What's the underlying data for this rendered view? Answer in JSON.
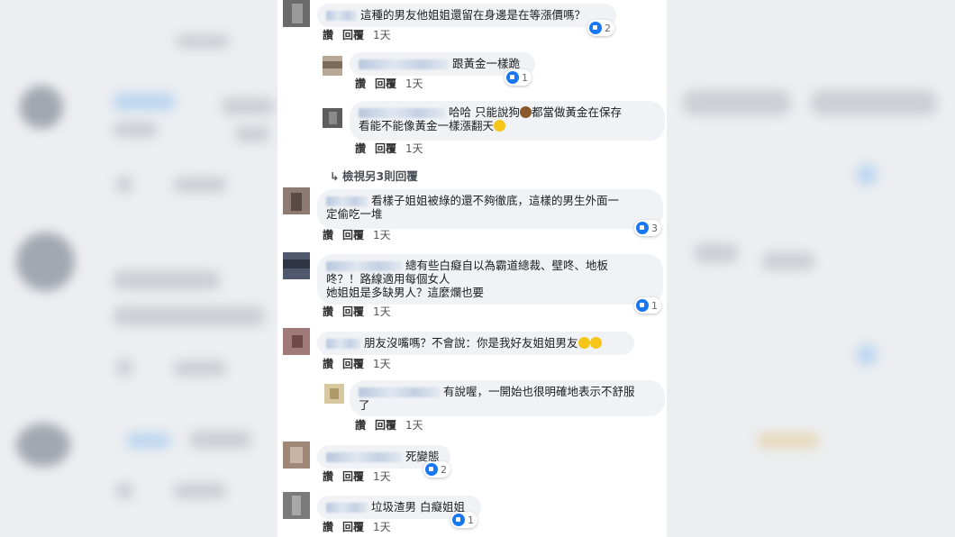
{
  "comments": [
    {
      "text": "這種的男友他姐姐還留在身邊是在等漲價嗎？",
      "likes": "2",
      "like": "讚",
      "reply": "回覆",
      "time": "1天"
    },
    {
      "text": "跟黃金一樣跪",
      "likes": "1",
      "like": "讚",
      "reply": "回覆",
      "time": "1天"
    },
    {
      "text1": "哈哈 只能說狗",
      "text2": "都當做黃金在保存",
      "text3": "看能不能像黃金一樣漲翻天",
      "like": "讚",
      "reply": "回覆",
      "time": "1天"
    },
    {
      "more": "檢視另3則回覆"
    },
    {
      "text1": "看樣子姐姐被綠的還不夠徹底，這樣的男生外面一",
      "text2": "定偷吃一堆",
      "likes": "3",
      "like": "讚",
      "reply": "回覆",
      "time": "1天"
    },
    {
      "text1": "總有些白癡自以為霸道總裁、壁咚、地板",
      "text2": "咚？！路線適用每個女人",
      "text3": "她姐姐是多缺男人？這麼爛也要",
      "likes": "1",
      "like": "讚",
      "reply": "回覆",
      "time": "1天"
    },
    {
      "text": "朋友沒嘴嗎？不會說：你是我好友姐姐男友",
      "like": "讚",
      "reply": "回覆",
      "time": "1天"
    },
    {
      "text1": "有說喔，一開始也很明確地表示不舒服",
      "text2": "了",
      "like": "讚",
      "reply": "回覆",
      "time": "1天"
    },
    {
      "text": "死變態",
      "likes": "2",
      "like": "讚",
      "reply": "回覆",
      "time": "1天"
    },
    {
      "text": "垃圾渣男 白癡姐姐",
      "likes": "1",
      "like": "讚",
      "reply": "回覆",
      "time": "1天"
    }
  ],
  "colors": {
    "like_blue": "#1877f2",
    "bubble": "#f0f2f5"
  },
  "icons": {
    "like": "thumbs-up-icon",
    "more": "reply-arrow-icon",
    "poop": "poop-emoji-icon",
    "laugh": "laughing-emoji-icon"
  }
}
